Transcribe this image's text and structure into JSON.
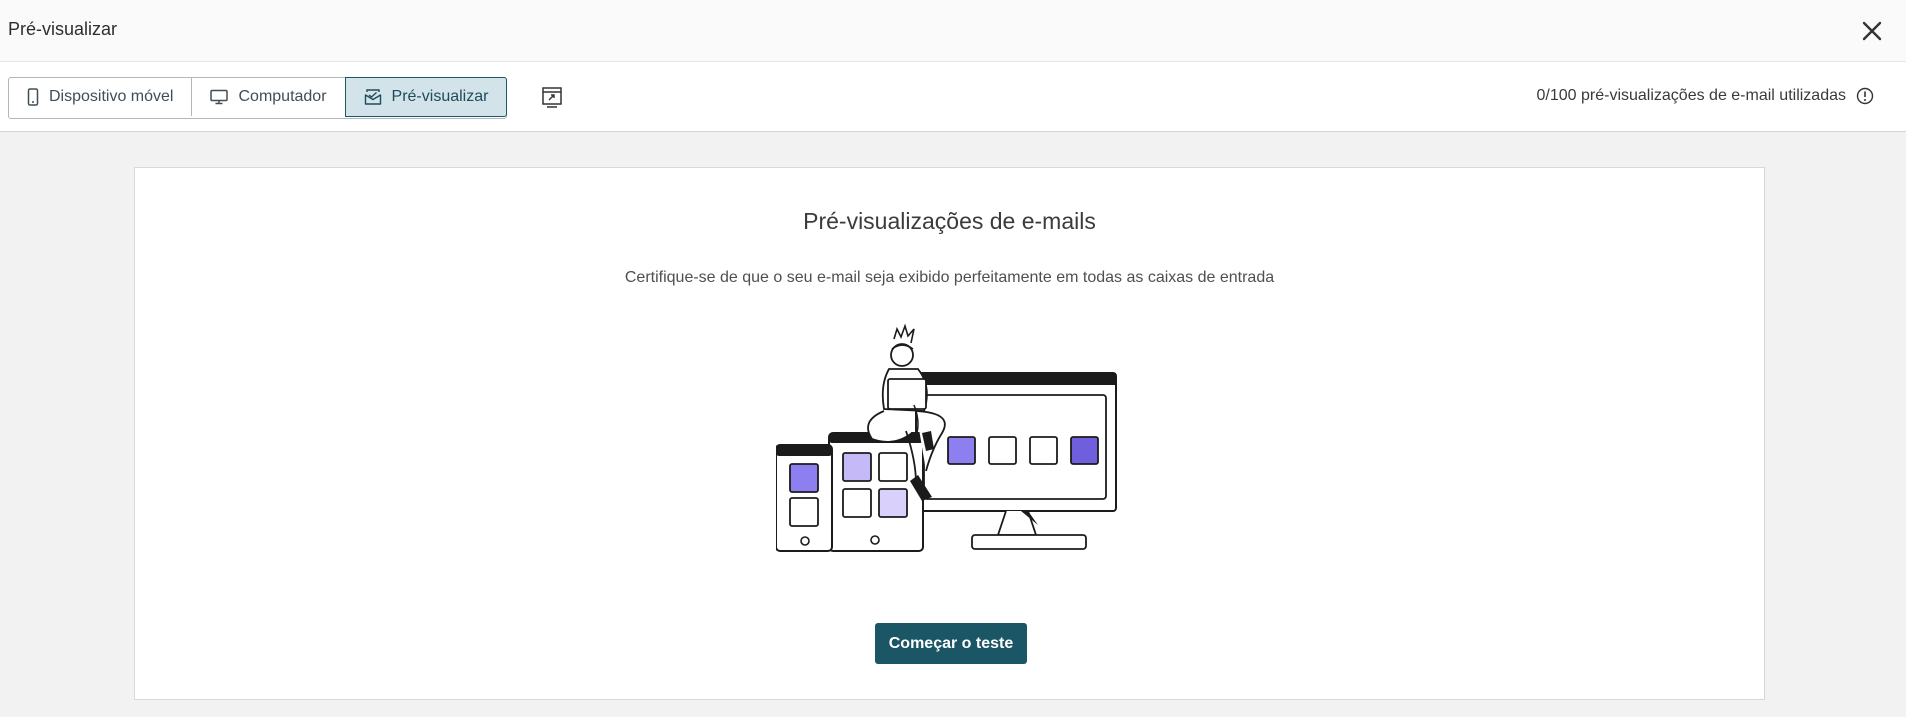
{
  "header": {
    "title": "Pré-visualizar",
    "close_icon": "close-icon"
  },
  "toolbar": {
    "tabs": [
      {
        "label": "Dispositivo móvel",
        "icon": "mobile-icon",
        "active": false
      },
      {
        "label": "Computador",
        "icon": "desktop-icon",
        "active": false
      },
      {
        "label": "Pré-visualizar",
        "icon": "email-preview-icon",
        "active": true
      }
    ],
    "extra_icon": "open-preview-icon",
    "usage_text": "0/100 pré-visualizações de e-mail utilizadas",
    "usage_icon": "info-icon"
  },
  "main": {
    "heading": "Pré-visualizações de e-mails",
    "description": "Certifique-se de que o seu e-mail seja exibido perfeitamente em todas as caixas de entrada",
    "start_button": "Começar o teste"
  },
  "colors": {
    "accent": "#1b5667",
    "active_tab_bg": "#d2e3ea",
    "illustration_purple": "#8e7ff0",
    "illustration_light_purple": "#c5b9f7"
  }
}
